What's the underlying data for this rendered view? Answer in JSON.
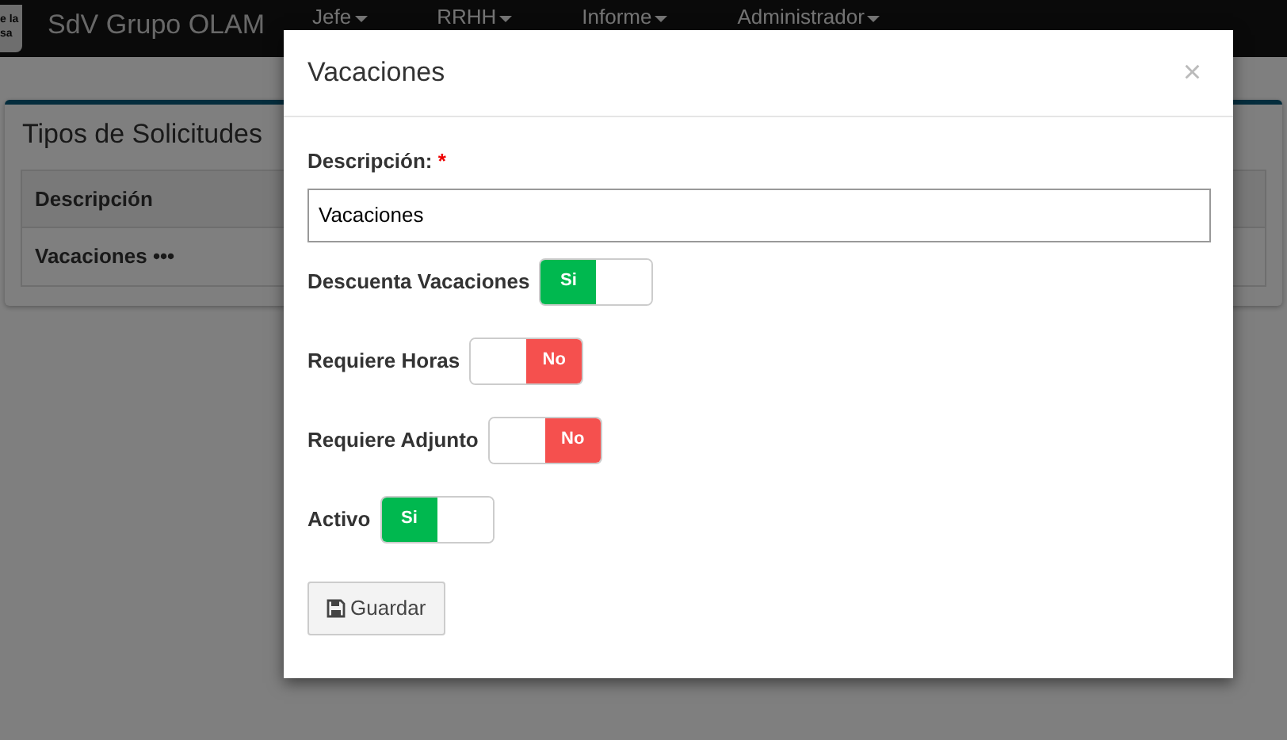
{
  "navbar": {
    "logo_lines": [
      "e la",
      "sa"
    ],
    "brand": "SdV Grupo OLAM",
    "menus": [
      {
        "label": "Jefe"
      },
      {
        "label": "RRHH"
      },
      {
        "label": "Informe"
      },
      {
        "label": "Administrador"
      }
    ]
  },
  "panel": {
    "title": "Tipos de Solicitudes",
    "table": {
      "columns": [
        "Descripción"
      ],
      "rows": [
        {
          "cells": [
            "Vacaciones •••"
          ]
        }
      ]
    }
  },
  "modal": {
    "title": "Vacaciones",
    "close": "×",
    "description": {
      "label": "Descripción:",
      "required_mark": "*",
      "value": "Vacaciones"
    },
    "toggles": [
      {
        "label": "Descuenta Vacaciones",
        "on": true,
        "text": "Si"
      },
      {
        "label": "Requiere Horas",
        "on": false,
        "text": "No"
      },
      {
        "label": "Requiere Adjunto",
        "on": false,
        "text": "No"
      },
      {
        "label": "Activo",
        "on": true,
        "text": "Si"
      }
    ],
    "save_button": "Guardar"
  }
}
